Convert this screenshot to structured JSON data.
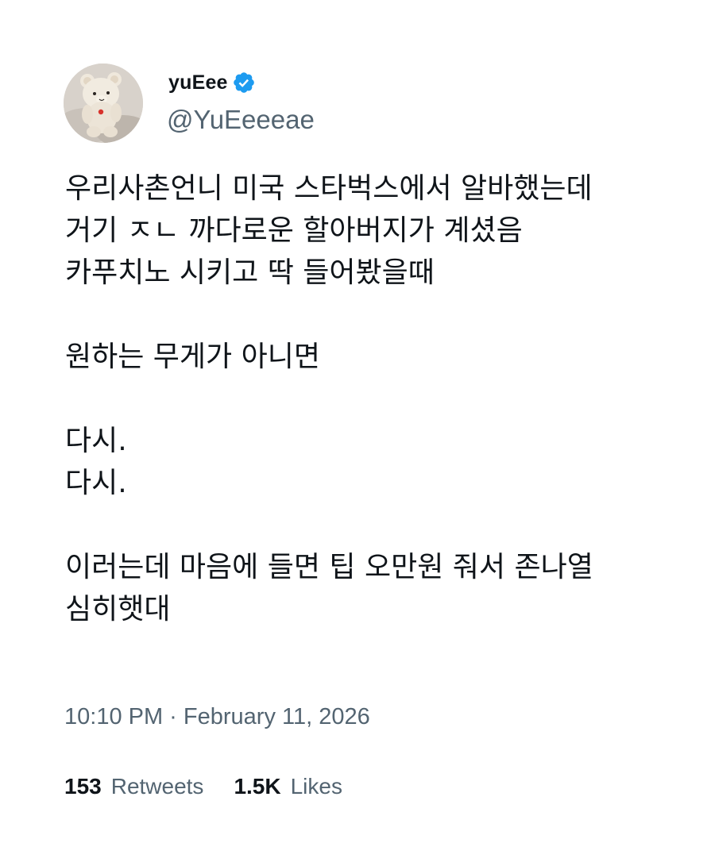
{
  "user": {
    "display_name": "yuEee",
    "handle": "@YuEeeeae",
    "verified": true,
    "verified_color": "#1d9bf0",
    "avatar_icon": "teddy-bear-avatar"
  },
  "tweet": {
    "lines": [
      "우리사촌언니 미국 스타벅스에서 알바했는데",
      "거기 ㅈㄴ 까다로운 할아버지가 계셨음",
      "카푸치노 시키고 딱 들어봤을때",
      "",
      "원하는 무게가 아니면",
      "",
      "다시.",
      "다시.",
      "",
      "이러는데 마음에 들면 팁 오만원 줘서 존나열",
      "심히햇대"
    ]
  },
  "meta": {
    "timestamp": "10:10 PM · February 11, 2026"
  },
  "stats": {
    "retweets_count": "153",
    "retweets_label": "Retweets",
    "likes_count": "1.5K",
    "likes_label": "Likes"
  },
  "colors": {
    "text": "#0f1419",
    "secondary": "#536471"
  }
}
